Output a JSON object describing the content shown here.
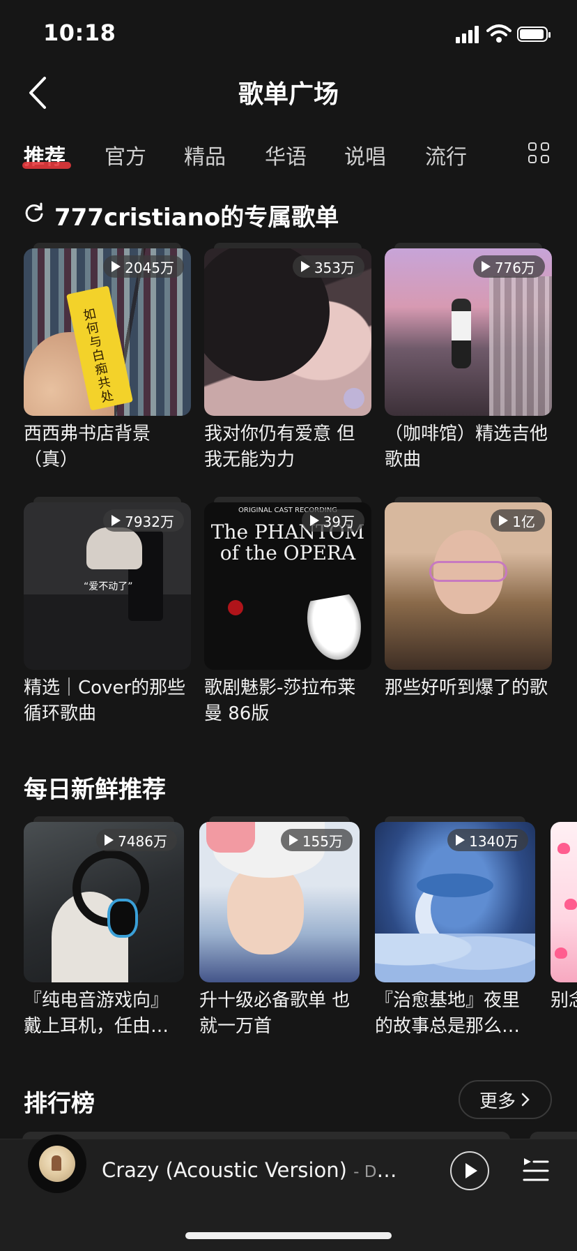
{
  "status_bar": {
    "time": "10:18"
  },
  "header": {
    "title": "歌单广场"
  },
  "tabs": [
    {
      "label": "推荐",
      "active": true
    },
    {
      "label": "官方"
    },
    {
      "label": "精品"
    },
    {
      "label": "华语"
    },
    {
      "label": "说唱"
    },
    {
      "label": "流行"
    }
  ],
  "personal_section": {
    "title": "777cristiano的专属歌单",
    "cards": [
      {
        "plays": "2045万",
        "title": "西西弗书店背景（真）",
        "cover_text": "如何与白痴共处",
        "icon": "bookstore-cover"
      },
      {
        "plays": "353万",
        "title": "我对你仍有爱意 但我无能为力",
        "icon": "anime-cover"
      },
      {
        "plays": "776万",
        "title": "（咖啡馆）精选吉他歌曲",
        "icon": "station-cover"
      },
      {
        "plays": "7932万",
        "title": "精选｜Cover的那些循环歌曲",
        "cover_text": "“爱不动了”",
        "icon": "dark-cover"
      },
      {
        "plays": "39万",
        "title": "歌剧魅影-莎拉布莱曼 86版",
        "cover_small": "ORIGINAL CAST RECORDING",
        "cover_title": "The PHANTOM of the OPERA",
        "icon": "opera-cover"
      },
      {
        "plays": "1亿",
        "title": "那些好听到爆了的歌",
        "icon": "girl-cover"
      }
    ]
  },
  "daily_section": {
    "title": "每日新鲜推荐",
    "cards": [
      {
        "plays": "7486万",
        "title": "『纯电音游戏向』戴上耳机，任由…",
        "icon": "headphone-cover"
      },
      {
        "plays": "155万",
        "title": "升十级必备歌单 也就一万首",
        "icon": "ski-cover"
      },
      {
        "plays": "1340万",
        "title": "『治愈基地』夜里的故事总是那么…",
        "icon": "night-cover"
      },
      {
        "title": "别念马上",
        "icon": "hearts-cover"
      }
    ]
  },
  "rank_section": {
    "title": "排行榜",
    "more_label": "更多"
  },
  "player": {
    "song": "Crazy (Acoustic Version)",
    "artist": "- David ..."
  },
  "colors": {
    "background": "#161616",
    "accent": "#e4393c"
  }
}
